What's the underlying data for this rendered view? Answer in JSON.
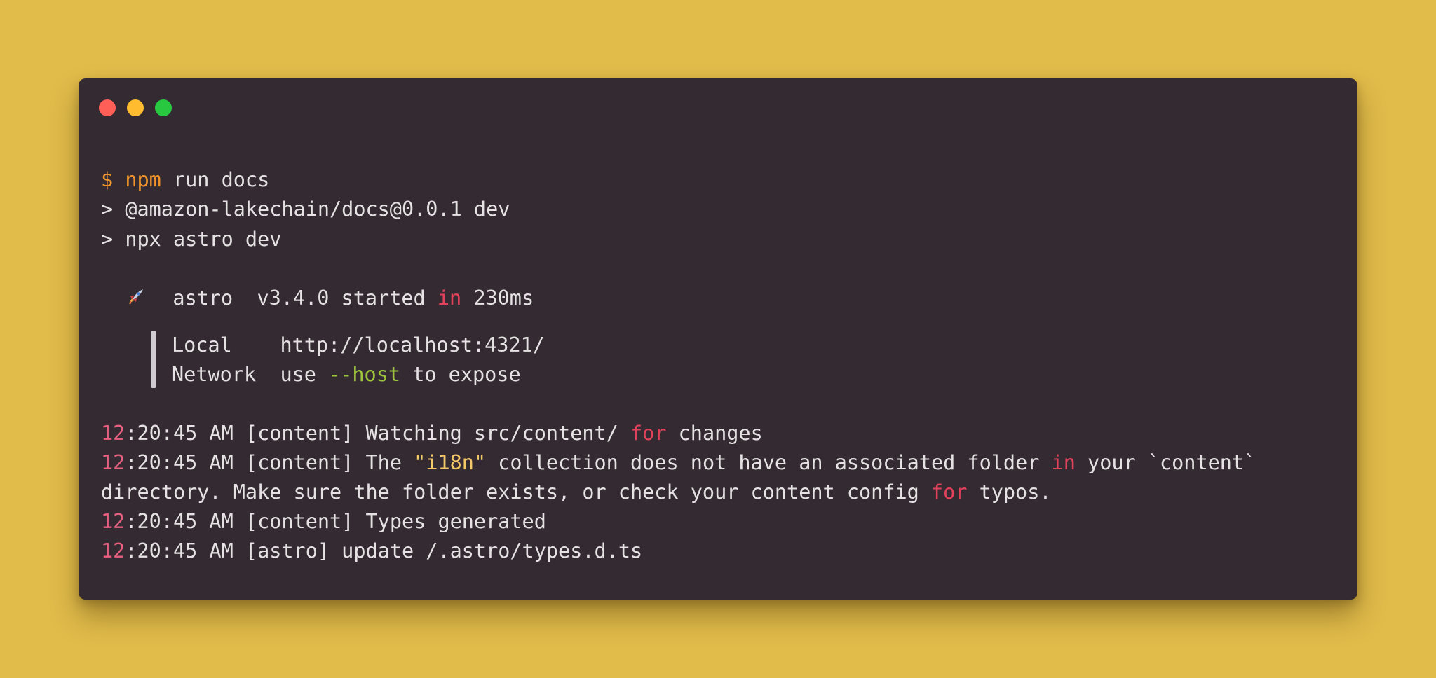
{
  "window": {
    "controls": [
      "close",
      "minimize",
      "maximize"
    ]
  },
  "command": {
    "prompt": "$",
    "program": "npm",
    "args": " run docs"
  },
  "npm_output": [
    "> @amazon-lakechain/docs@0.0.1 dev",
    "> npx astro dev"
  ],
  "astro_banner": {
    "icon": "rocket-icon",
    "name": "astro",
    "version_before": "v3.4.0 started ",
    "keyword_in": "in",
    "time": " 230ms"
  },
  "server_info": {
    "local_label": "Local",
    "local_url": "http://localhost:4321/",
    "network_label": "Network",
    "network_prefix": "use ",
    "network_flag": "--host",
    "network_suffix": " to expose"
  },
  "log": {
    "line1": {
      "hour": "12",
      "rest": ":20:45 AM [content] Watching src/content/ ",
      "kw": "for",
      "end": " changes"
    },
    "line2": {
      "hour": "12",
      "rest": ":20:45 AM [content] The ",
      "string": "\"i18n\"",
      "mid": " collection does not have an associated folder ",
      "kw": "in",
      "end": " your `content`"
    },
    "line3": {
      "text": "directory. Make sure the folder exists, or check your content config ",
      "kw": "for",
      "end": " typos."
    },
    "line4": {
      "hour": "12",
      "rest": ":20:45 AM [content] Types generated"
    },
    "line5": {
      "hour": "12",
      "rest": ":20:45 AM [astro] update /.astro/types.d.ts"
    }
  },
  "colors": {
    "background": "#e1bc4a",
    "window": "#332a32",
    "text": "#e6e2e4",
    "prompt": "#f0932a",
    "keyword": "#e0425a",
    "flag": "#9ec43f",
    "string": "#f3c866",
    "timestamp_hour": "#e6607f"
  }
}
